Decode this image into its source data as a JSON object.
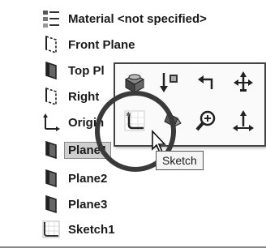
{
  "tree": {
    "items": [
      {
        "label": "Material <not specified>",
        "icon": "material-icon"
      },
      {
        "label": "Front Plane",
        "icon": "plane-icon"
      },
      {
        "label": "Top Pl",
        "icon": "plane-icon"
      },
      {
        "label": "Right",
        "icon": "plane-icon"
      },
      {
        "label": "Origin",
        "icon": "origin-icon"
      },
      {
        "label": "Plane1",
        "icon": "plane-icon",
        "selected": true
      },
      {
        "label": "Plane2",
        "icon": "plane-icon"
      },
      {
        "label": "Plane3",
        "icon": "plane-icon"
      },
      {
        "label": "Sketch1",
        "icon": "sketch-icon"
      }
    ]
  },
  "context_toolbar": {
    "buttons": [
      {
        "icon": "section-view-icon"
      },
      {
        "icon": "normal-to-icon"
      },
      {
        "icon": "undo-arrow-icon"
      },
      {
        "icon": "move-triad-icon"
      },
      {
        "icon": "sketch-icon"
      },
      {
        "icon": "edit-appearance-icon"
      },
      {
        "icon": "zoom-to-selection-icon"
      },
      {
        "icon": "triad-icon"
      }
    ]
  },
  "tooltip": {
    "text": "Sketch"
  }
}
